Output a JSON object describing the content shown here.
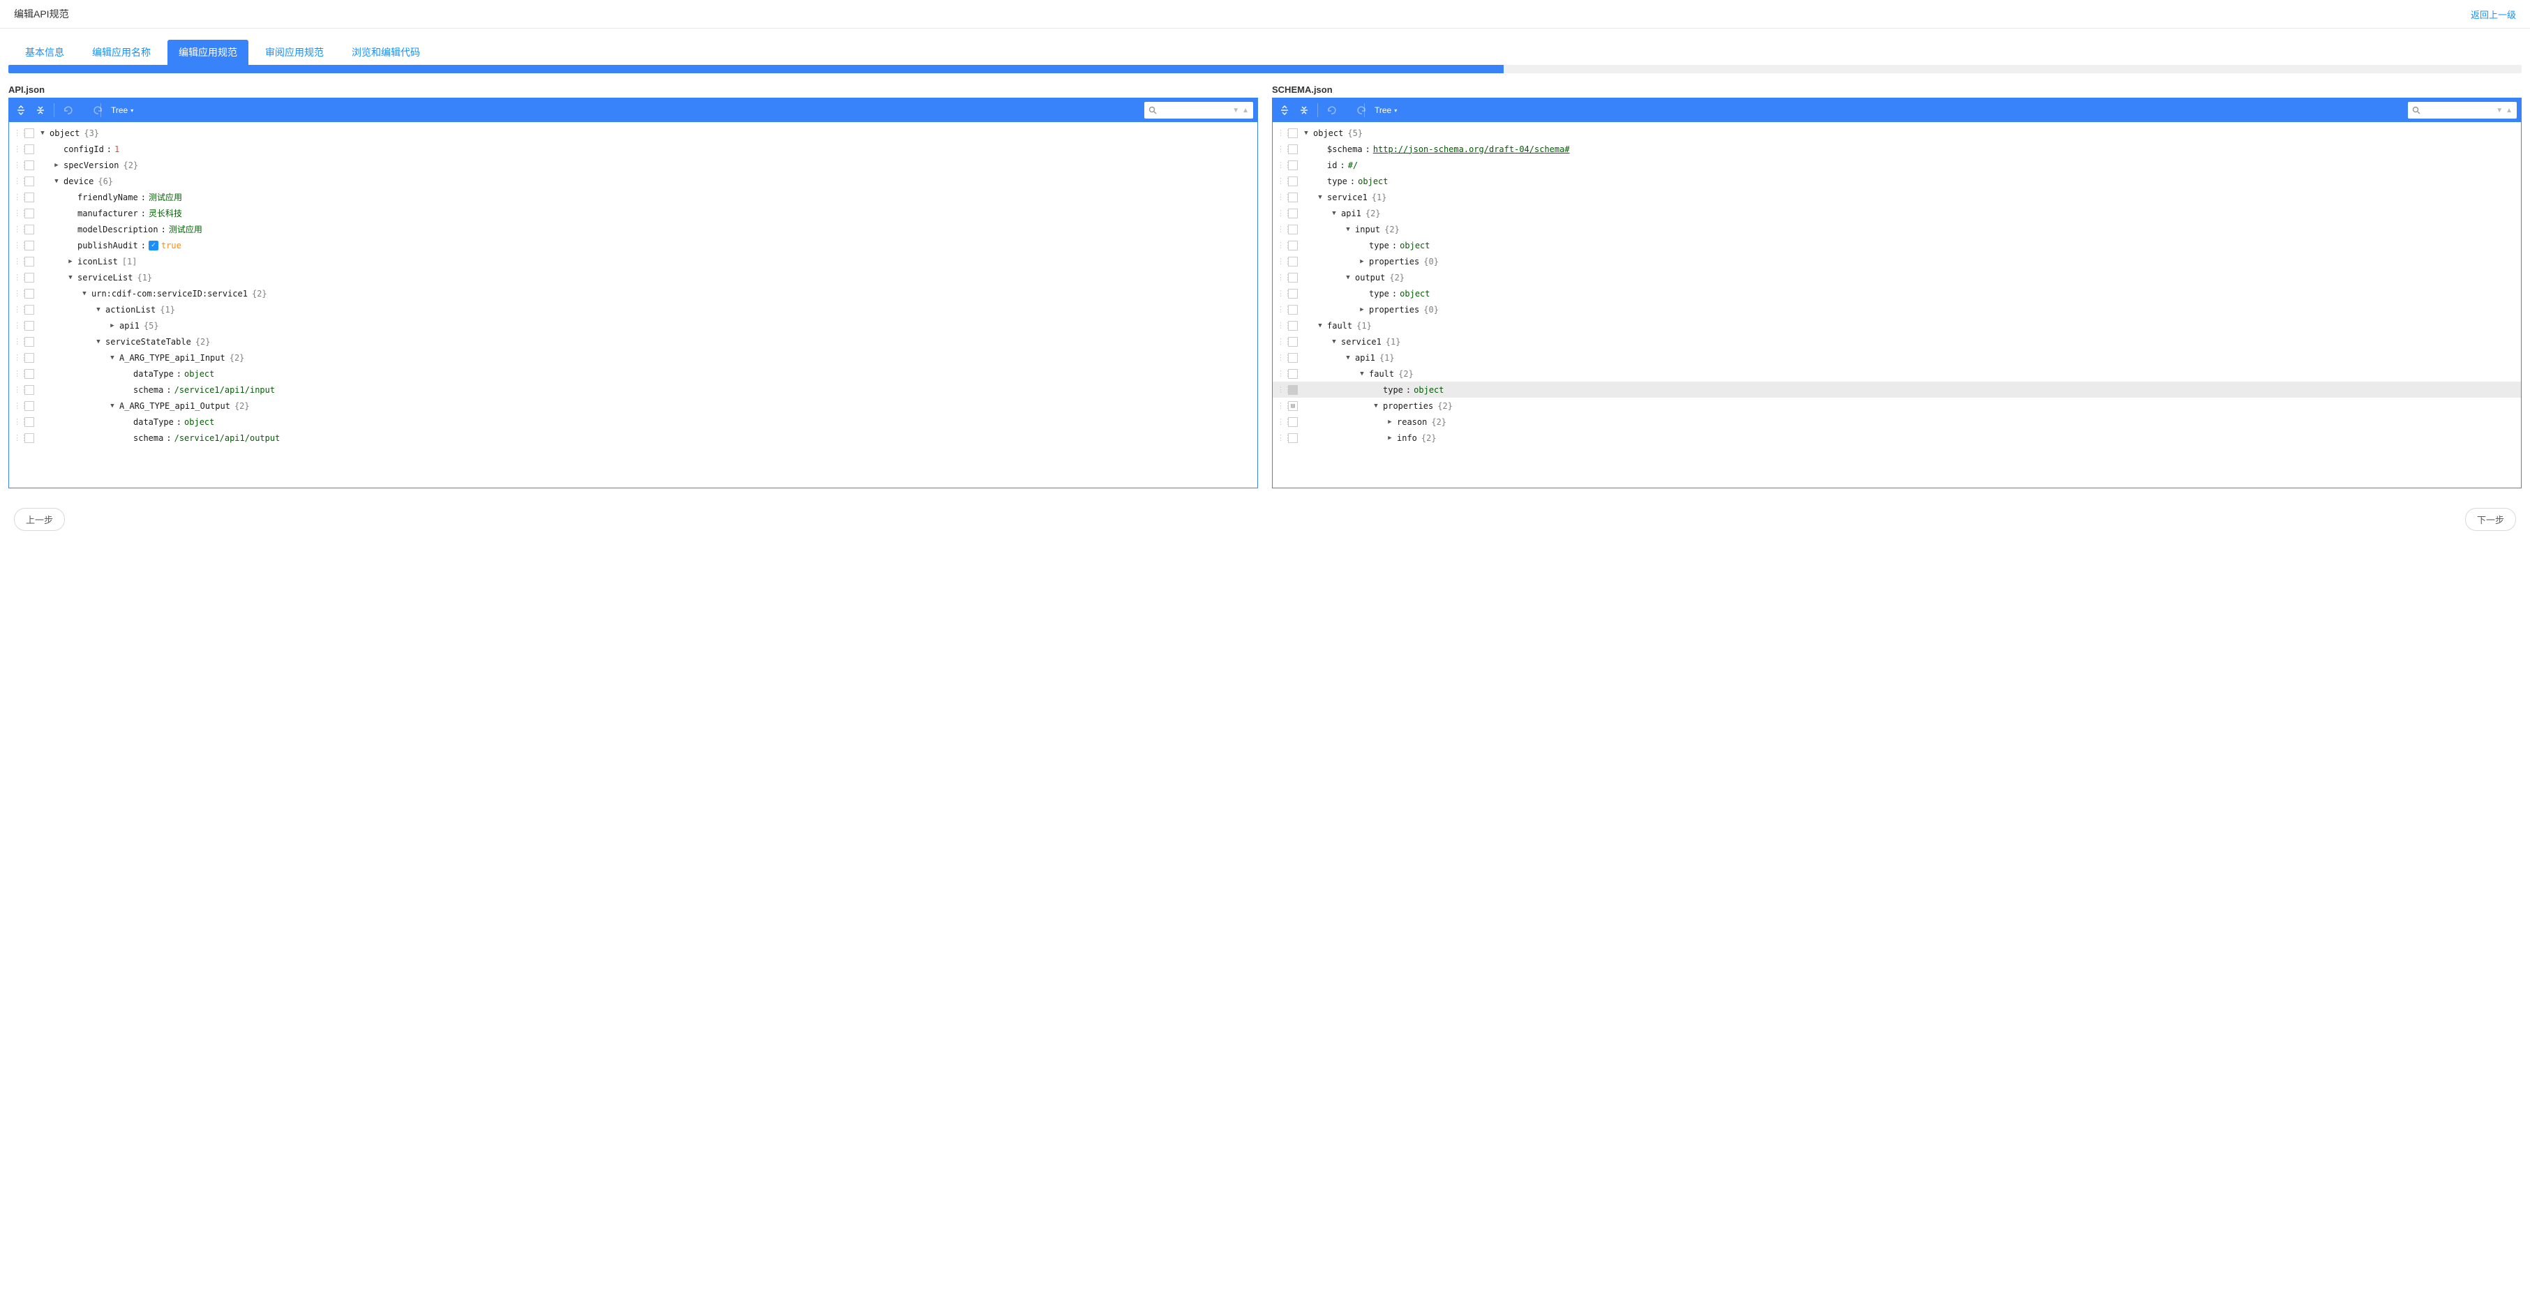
{
  "header": {
    "title": "编辑API规范",
    "back_link": "返回上一级"
  },
  "tabs": [
    {
      "label": "基本信息",
      "active": false
    },
    {
      "label": "编辑应用名称",
      "active": false
    },
    {
      "label": "编辑应用规范",
      "active": true
    },
    {
      "label": "审阅应用规范",
      "active": false
    },
    {
      "label": "浏览和编辑代码",
      "active": false
    }
  ],
  "progress_percent": 59.5,
  "panel_left": {
    "title": "API.json",
    "mode": "Tree",
    "tree": [
      {
        "indent": 0,
        "toggle": "down",
        "key": "object",
        "count": "{3}"
      },
      {
        "indent": 1,
        "toggle": "",
        "key": "configId",
        "sep": ":",
        "val": "1",
        "vtype": "num"
      },
      {
        "indent": 1,
        "toggle": "right",
        "key": "specVersion",
        "count": "{2}"
      },
      {
        "indent": 1,
        "toggle": "down",
        "key": "device",
        "count": "{6}"
      },
      {
        "indent": 2,
        "toggle": "",
        "key": "friendlyName",
        "sep": ":",
        "val": "测试应用",
        "vtype": "str"
      },
      {
        "indent": 2,
        "toggle": "",
        "key": "manufacturer",
        "sep": ":",
        "val": "灵长科技",
        "vtype": "str"
      },
      {
        "indent": 2,
        "toggle": "",
        "key": "modelDescription",
        "sep": ":",
        "val": "测试应用",
        "vtype": "str"
      },
      {
        "indent": 2,
        "toggle": "",
        "key": "publishAudit",
        "sep": ":",
        "val": "true",
        "vtype": "bool",
        "chk": true
      },
      {
        "indent": 2,
        "toggle": "right",
        "key": "iconList",
        "count": "[1]"
      },
      {
        "indent": 2,
        "toggle": "down",
        "key": "serviceList",
        "count": "{1}"
      },
      {
        "indent": 3,
        "toggle": "down",
        "key": "urn:cdif-com:serviceID:service1",
        "count": "{2}"
      },
      {
        "indent": 4,
        "toggle": "down",
        "key": "actionList",
        "count": "{1}"
      },
      {
        "indent": 5,
        "toggle": "right",
        "key": "api1",
        "count": "{5}"
      },
      {
        "indent": 4,
        "toggle": "down",
        "key": "serviceStateTable",
        "count": "{2}"
      },
      {
        "indent": 5,
        "toggle": "down",
        "key": "A_ARG_TYPE_api1_Input",
        "count": "{2}"
      },
      {
        "indent": 6,
        "toggle": "",
        "key": "dataType",
        "sep": ":",
        "val": "object",
        "vtype": "str"
      },
      {
        "indent": 6,
        "toggle": "",
        "key": "schema",
        "sep": ":",
        "val": "/service1/api1/input",
        "vtype": "str"
      },
      {
        "indent": 5,
        "toggle": "down",
        "key": "A_ARG_TYPE_api1_Output",
        "count": "{2}"
      },
      {
        "indent": 6,
        "toggle": "",
        "key": "dataType",
        "sep": ":",
        "val": "object",
        "vtype": "str"
      },
      {
        "indent": 6,
        "toggle": "",
        "key": "schema",
        "sep": ":",
        "val": "/service1/api1/output",
        "vtype": "str"
      }
    ]
  },
  "panel_right": {
    "title": "SCHEMA.json",
    "mode": "Tree",
    "tree": [
      {
        "indent": 0,
        "toggle": "down",
        "key": "object",
        "count": "{5}"
      },
      {
        "indent": 1,
        "toggle": "",
        "key": "$schema",
        "sep": ":",
        "val": "http://json-schema.org/draft-04/schema#",
        "vtype": "link"
      },
      {
        "indent": 1,
        "toggle": "",
        "key": "id",
        "sep": ":",
        "val": "#/",
        "vtype": "str"
      },
      {
        "indent": 1,
        "toggle": "",
        "key": "type",
        "sep": ":",
        "val": "object",
        "vtype": "str"
      },
      {
        "indent": 1,
        "toggle": "down",
        "key": "service1",
        "count": "{1}"
      },
      {
        "indent": 2,
        "toggle": "down",
        "key": "api1",
        "count": "{2}"
      },
      {
        "indent": 3,
        "toggle": "down",
        "key": "input",
        "count": "{2}"
      },
      {
        "indent": 4,
        "toggle": "",
        "key": "type",
        "sep": ":",
        "val": "object",
        "vtype": "str"
      },
      {
        "indent": 4,
        "toggle": "right",
        "key": "properties",
        "count": "{0}"
      },
      {
        "indent": 3,
        "toggle": "down",
        "key": "output",
        "count": "{2}"
      },
      {
        "indent": 4,
        "toggle": "",
        "key": "type",
        "sep": ":",
        "val": "object",
        "vtype": "str"
      },
      {
        "indent": 4,
        "toggle": "right",
        "key": "properties",
        "count": "{0}"
      },
      {
        "indent": 1,
        "toggle": "down",
        "key": "fault",
        "count": "{1}"
      },
      {
        "indent": 2,
        "toggle": "down",
        "key": "service1",
        "count": "{1}"
      },
      {
        "indent": 3,
        "toggle": "down",
        "key": "api1",
        "count": "{1}"
      },
      {
        "indent": 4,
        "toggle": "down",
        "key": "fault",
        "count": "{2}"
      },
      {
        "indent": 5,
        "toggle": "",
        "key": "type",
        "sep": ":",
        "val": "object",
        "vtype": "str",
        "highlight": true,
        "ctxfilled": true
      },
      {
        "indent": 5,
        "toggle": "down",
        "key": "properties",
        "count": "{2}",
        "boxed": true
      },
      {
        "indent": 6,
        "toggle": "right",
        "key": "reason",
        "count": "{2}"
      },
      {
        "indent": 6,
        "toggle": "right",
        "key": "info",
        "count": "{2}"
      }
    ]
  },
  "footer": {
    "prev": "上一步",
    "next": "下一步"
  }
}
